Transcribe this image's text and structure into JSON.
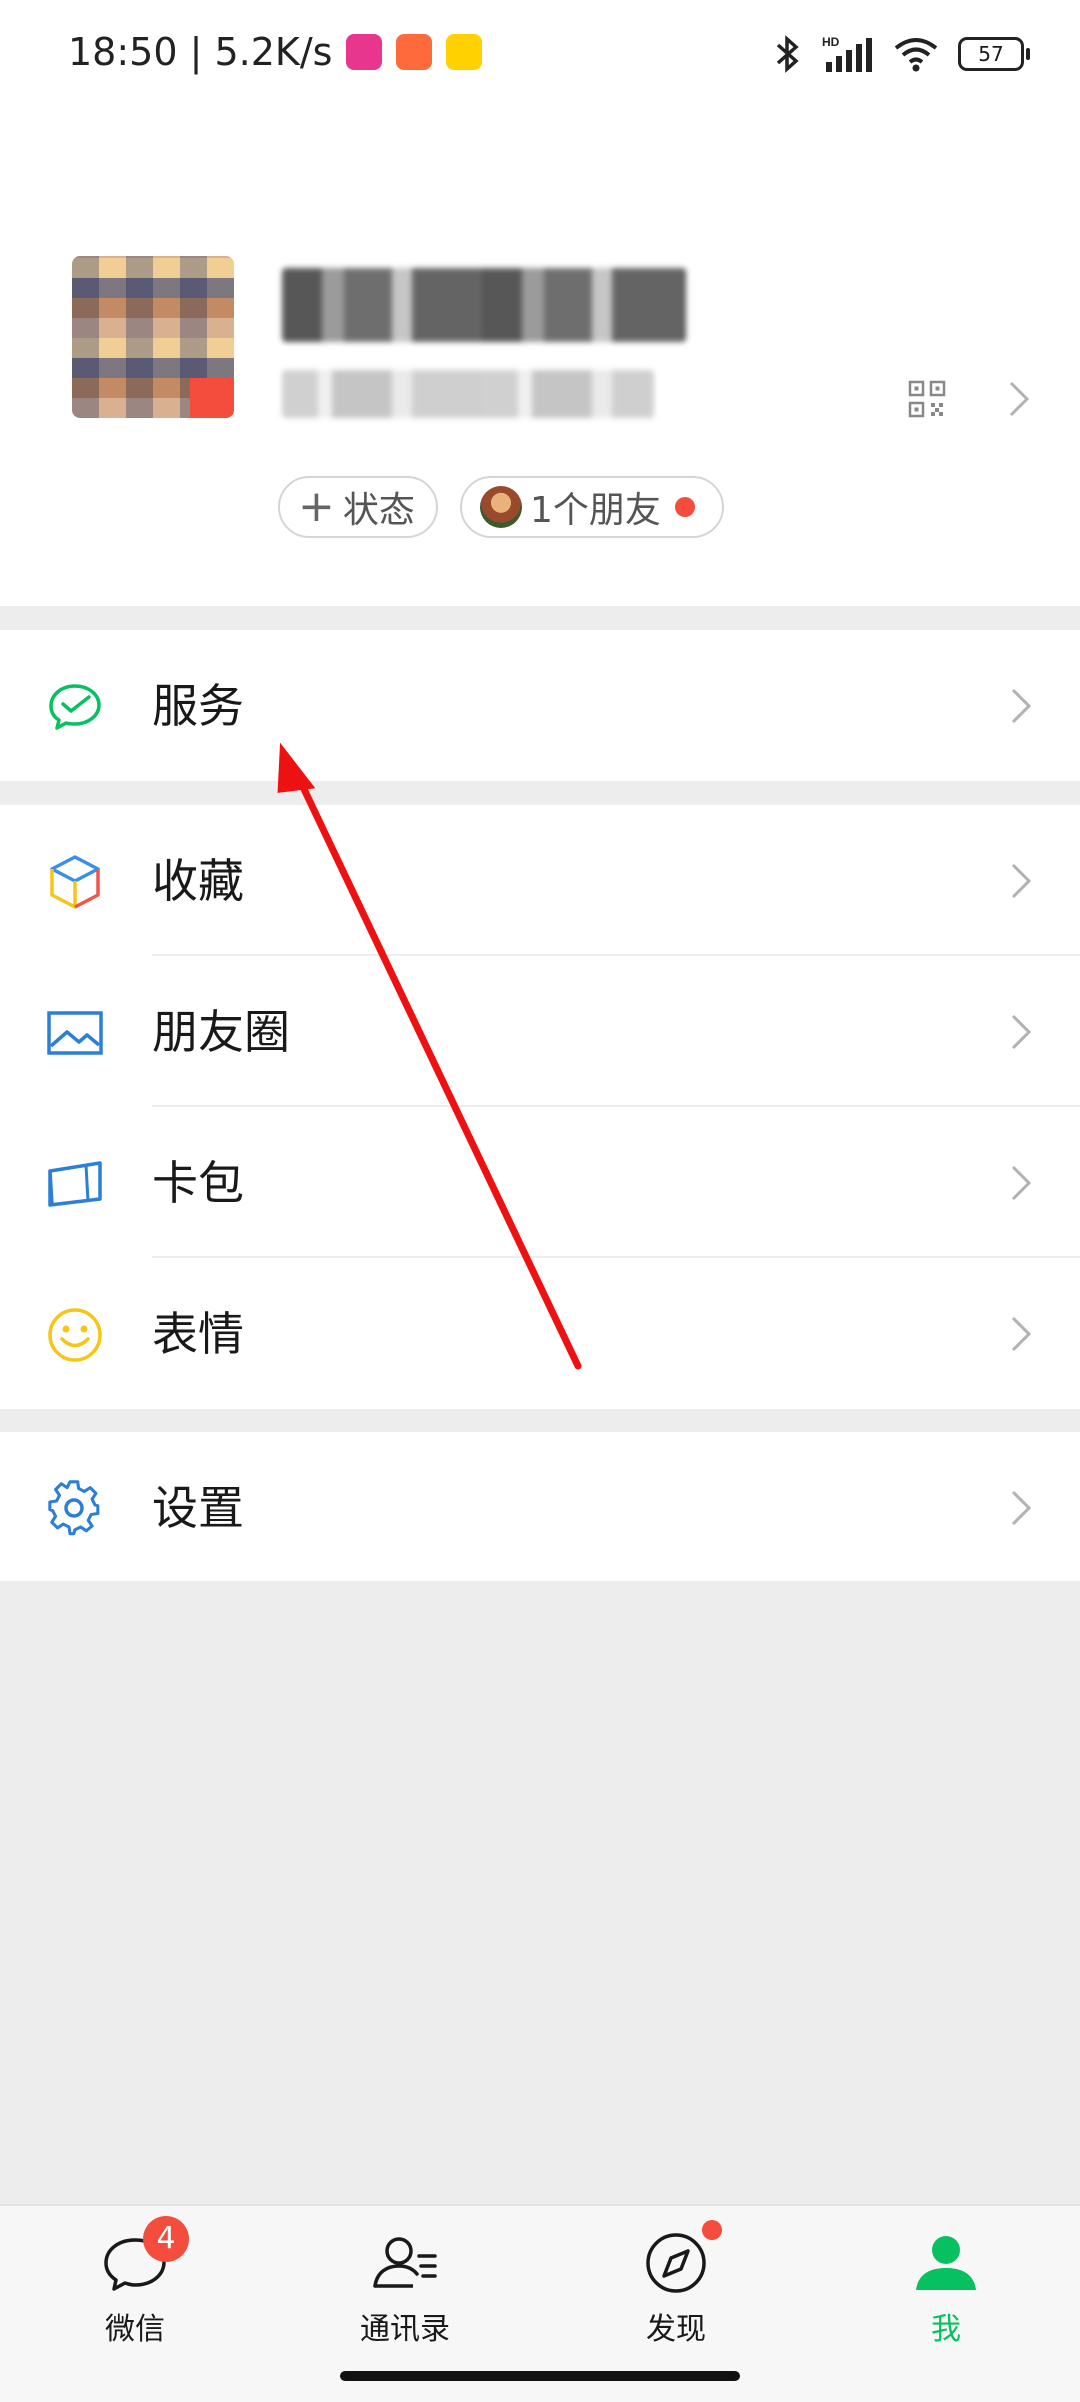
{
  "status_bar": {
    "time_speed": "18:50 | 5.2K/s",
    "app_icons": [
      {
        "name": "vipshop-icon",
        "color": "#e8368f",
        "text": "唯品会"
      },
      {
        "name": "app-orange-icon",
        "color": "#ff6a3d",
        "text": ""
      },
      {
        "name": "meituan-icon",
        "color": "#ffd100",
        "text": "美团"
      }
    ],
    "battery": "57",
    "network": "HD"
  },
  "profile": {
    "status_button": "状态",
    "friends_button": "1个朋友"
  },
  "menu": {
    "services": {
      "label": "服务",
      "icon": "wechat-pay-icon",
      "color": "#07c160"
    },
    "favorites": {
      "label": "收藏",
      "icon": "cube-icon"
    },
    "moments": {
      "label": "朋友圈",
      "icon": "picture-icon",
      "color": "#2c7fd6"
    },
    "cards": {
      "label": "卡包",
      "icon": "card-icon",
      "color": "#2c7fd6"
    },
    "stickers": {
      "label": "表情",
      "icon": "smile-icon",
      "color": "#f5c518"
    },
    "settings": {
      "label": "设置",
      "icon": "gear-icon",
      "color": "#2c7fd6"
    }
  },
  "bottom_nav": {
    "chats": {
      "label": "微信",
      "badge": "4"
    },
    "contacts": {
      "label": "通讯录"
    },
    "discover": {
      "label": "发现"
    },
    "me": {
      "label": "我",
      "active_color": "#07c160"
    }
  }
}
